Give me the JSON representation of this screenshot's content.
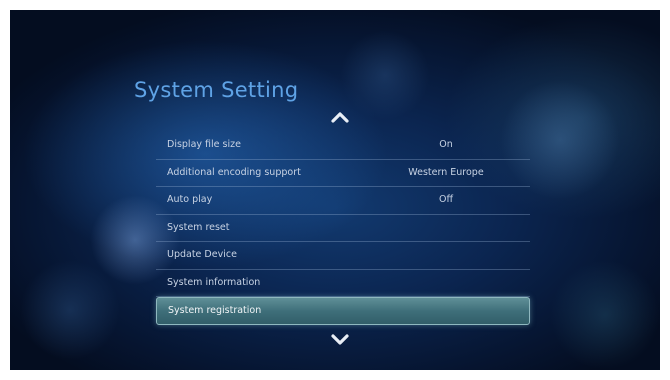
{
  "screen": {
    "title": "System Setting"
  },
  "menu": {
    "items": [
      {
        "label": "Display file size",
        "value": "On"
      },
      {
        "label": "Additional encoding support",
        "value": "Western Europe"
      },
      {
        "label": "Auto play",
        "value": "Off"
      },
      {
        "label": "System reset",
        "value": ""
      },
      {
        "label": "Update Device",
        "value": ""
      },
      {
        "label": "System information",
        "value": ""
      },
      {
        "label": "System registration",
        "value": ""
      }
    ],
    "selected_item": "System registration"
  },
  "icons": {
    "scroll_up": "chevron-up-icon",
    "scroll_down": "chevron-down-icon"
  },
  "colors": {
    "title": "#5fa3e6",
    "text": "#c8d3e4",
    "highlight": "#4a7f88",
    "background": "#0b2550"
  }
}
